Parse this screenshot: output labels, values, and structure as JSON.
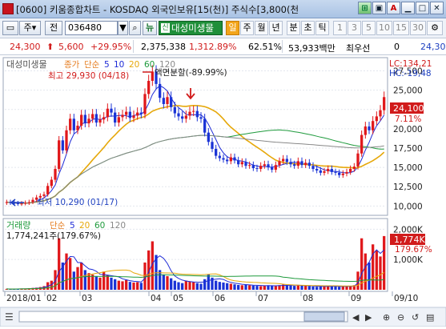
{
  "window": {
    "title": "[0600] 키움종합차트 - KOSDAQ 외국인보유[15(천)] 주식수[3,800(천",
    "buttons": [
      "fit-icon",
      "A",
      "minimize",
      "maximize",
      "close"
    ]
  },
  "toolbar": {
    "type_select": "주",
    "prev_label": "전",
    "code": "036480",
    "code_dropdown": "▼",
    "search_icon": "search-icon",
    "news_label": "뉴",
    "news_dropdown": "▼",
    "stock_name_prefix": "신",
    "stock_name": "대성미생물",
    "periods": [
      "일",
      "주",
      "월",
      "년",
      "분",
      "초",
      "틱"
    ],
    "selected_period": "일",
    "interval_buttons": [
      "1",
      "3",
      "5",
      "10",
      "15",
      "30"
    ]
  },
  "quote": {
    "price": "24,300",
    "change": "5,600",
    "change_pct": "+29.95%",
    "volume": "2,375,338",
    "volume_ratio": "1,312.89%",
    "turnover": "62.51%",
    "amount": "53,933백만",
    "lowest_label": "최우선",
    "val1": "0",
    "val2": "24,30"
  },
  "chart_data": [
    {
      "type": "candlestick",
      "title": "대성미생물",
      "legend": [
        {
          "name": "종가",
          "color": "#e67e22"
        },
        {
          "name": "단순",
          "color": "#e67e22"
        },
        {
          "name": "5",
          "color": "#1e2bd6"
        },
        {
          "name": "10",
          "color": "#1e2bd6"
        },
        {
          "name": "20",
          "color": "#e6a80a"
        },
        {
          "name": "60",
          "color": "#1e9a3c"
        },
        {
          "name": "120",
          "color": "#888888"
        }
      ],
      "annotations": [
        {
          "text": "최고 29,930 (04/18)",
          "color": "#d11b1b"
        },
        {
          "text": "액면분할(-89.99%)",
          "color": "#1a1a1a"
        },
        {
          "text": "최저 10,290 (01/17)",
          "color": "#1d3fbf"
        }
      ],
      "y_ticks": [
        "27,500",
        "25,000",
        "22,500",
        "20,000",
        "17,500",
        "15,000",
        "12,500",
        "10,000"
      ],
      "ylim": [
        9000,
        29000
      ],
      "hi_label": "LC:134,21",
      "lo_label": "HC:-19,48",
      "last_price": "24,100",
      "last_pct": "7.11%",
      "x_labels": [
        "2018/01",
        "02",
        "03",
        "04",
        "05",
        "06",
        "07",
        "08",
        "09",
        "09/10"
      ],
      "closes": [
        10500,
        10400,
        10350,
        10300,
        10320,
        10400,
        10500,
        10800,
        11100,
        11300,
        11500,
        12600,
        13400,
        14800,
        18500,
        17200,
        19800,
        21300,
        19800,
        20400,
        21800,
        20700,
        21300,
        21900,
        20800,
        21200,
        21500,
        22600,
        22100,
        20800,
        21500,
        21800,
        22200,
        21400,
        21700,
        22100,
        21900,
        24500,
        26200,
        27400,
        25800,
        24000,
        23200,
        24100,
        22800,
        22000,
        21600,
        21300,
        21700,
        22200,
        22300,
        21500,
        21300,
        19500,
        18300,
        17400,
        16500,
        16200,
        16000,
        15800,
        16300,
        15900,
        15400,
        15700,
        15200,
        15300,
        14900,
        14800,
        15200,
        15400,
        15000,
        14700,
        15300,
        15800,
        16100,
        15700,
        15400,
        15200,
        15800,
        15300,
        15600,
        15200,
        14800,
        14600,
        14300,
        14500,
        14800,
        14400,
        14300,
        14000,
        14200,
        14400,
        14800,
        15100,
        16800,
        19200,
        20300,
        19800,
        21000,
        21600,
        22400,
        24100
      ],
      "opens": [
        10400,
        10500,
        10400,
        10350,
        10300,
        10350,
        10400,
        10500,
        10800,
        11100,
        11300,
        11500,
        12600,
        13400,
        14800,
        18500,
        17200,
        19800,
        21300,
        19800,
        20400,
        21800,
        20700,
        21300,
        21900,
        20800,
        21200,
        21500,
        22600,
        22100,
        20800,
        21500,
        21800,
        22200,
        21400,
        21700,
        22100,
        21900,
        24500,
        26200,
        27400,
        25800,
        24000,
        23200,
        24100,
        22800,
        22000,
        21600,
        21300,
        21700,
        22200,
        22300,
        21500,
        21300,
        19500,
        18300,
        17400,
        16500,
        16200,
        16000,
        15800,
        16300,
        15900,
        15400,
        15700,
        15200,
        15300,
        14900,
        14800,
        15200,
        15400,
        15000,
        14700,
        15300,
        15800,
        16100,
        15700,
        15400,
        15200,
        15800,
        15300,
        15600,
        15200,
        14800,
        14600,
        14300,
        14500,
        14800,
        14400,
        14300,
        14000,
        14200,
        14400,
        14800,
        15100,
        16800,
        19200,
        20300,
        19800,
        21000,
        21600,
        22400
      ]
    },
    {
      "type": "bar",
      "title": "거래량",
      "legend": [
        {
          "name": "단순",
          "color": "#e67e22"
        },
        {
          "name": "5",
          "color": "#1e2bd6"
        },
        {
          "name": "20",
          "color": "#e6a80a"
        },
        {
          "name": "60",
          "color": "#1e9a3c"
        },
        {
          "name": "120",
          "color": "#888888"
        }
      ],
      "volume_text": "1,774,241주(179.67%)",
      "y_ticks": [
        "2,000K",
        "1,000K"
      ],
      "ylim": [
        0,
        2300
      ],
      "last_value": "1,774K",
      "last_pct": "179.67%",
      "values_k": [
        30,
        20,
        25,
        30,
        35,
        40,
        50,
        60,
        70,
        90,
        120,
        250,
        300,
        650,
        1700,
        900,
        1200,
        1050,
        600,
        750,
        900,
        650,
        550,
        500,
        450,
        400,
        600,
        480,
        400,
        350,
        300,
        280,
        320,
        260,
        240,
        250,
        230,
        900,
        1300,
        1600,
        1150,
        650,
        500,
        450,
        380,
        300,
        250,
        220,
        300,
        280,
        250,
        220,
        200,
        350,
        500,
        400,
        300,
        260,
        240,
        220,
        200,
        180,
        160,
        150,
        170,
        150,
        140,
        130,
        120,
        140,
        150,
        130,
        120,
        150,
        170,
        160,
        140,
        130,
        150,
        140,
        130,
        120,
        110,
        100,
        120,
        110,
        130,
        120,
        110,
        100,
        120,
        110,
        130,
        150,
        600,
        1700,
        1200,
        900,
        1500,
        1300,
        1100,
        1774
      ]
    }
  ],
  "status": {
    "icons": [
      "hand-icon",
      "scroll-left",
      "scroll-right",
      "zoom-in",
      "zoom-out"
    ]
  }
}
